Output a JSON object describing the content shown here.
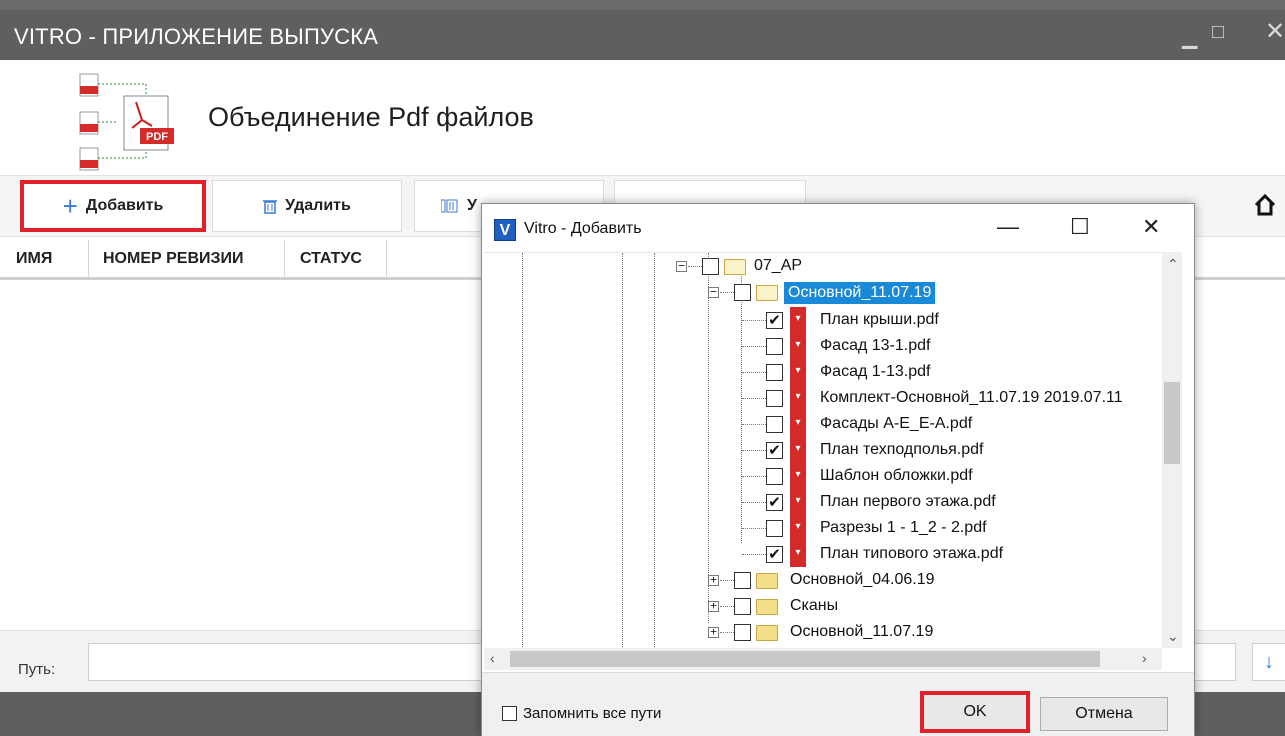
{
  "app": {
    "title": "VITRO - ПРИЛОЖЕНИЕ ВЫПУСКА",
    "heading": "Объединение Pdf файлов",
    "window_controls": {
      "minimize": "▁",
      "maximize": "□",
      "close": "✕"
    }
  },
  "toolbar": {
    "add_label": "Добавить",
    "delete_label": "Удалить",
    "third_label": "У",
    "home_icon": "home-icon"
  },
  "columns": [
    "ИМЯ",
    "НОМЕР РЕВИЗИИ",
    "СТАТУС"
  ],
  "path": {
    "label": "Путь:",
    "value": ""
  },
  "colors": {
    "accent_red": "#e0202a",
    "selection_blue": "#1a8ad8",
    "titlebar": "#5f5f5f"
  },
  "dialog": {
    "title": "Vitro - Добавить",
    "icon_letter": "V",
    "controls": {
      "minimize": "—",
      "maximize": "☐",
      "close": "✕"
    },
    "tree": {
      "root_folder": "07_АР",
      "selected_folder": "Основной_11.07.19",
      "files": [
        {
          "name": "План крыши.pdf",
          "checked": true
        },
        {
          "name": "Фасад 13-1.pdf",
          "checked": false
        },
        {
          "name": "Фасад 1-13.pdf",
          "checked": false
        },
        {
          "name": "Комплект-Основной_11.07.19 2019.07.11",
          "checked": false
        },
        {
          "name": "Фасады А-Е_Е-А.pdf",
          "checked": false
        },
        {
          "name": "План техподполья.pdf",
          "checked": true
        },
        {
          "name": "Шаблон обложки.pdf",
          "checked": false
        },
        {
          "name": "План первого этажа.pdf",
          "checked": true
        },
        {
          "name": "Разрезы 1 - 1_2 - 2.pdf",
          "checked": false
        },
        {
          "name": "План типового этажа.pdf",
          "checked": true
        }
      ],
      "sibling_folders": [
        "Основной_04.06.19",
        "Сканы",
        "Основной_11.07.19"
      ]
    },
    "remember_label": "Запомнить все пути",
    "ok_label": "OK",
    "cancel_label": "Отмена"
  }
}
